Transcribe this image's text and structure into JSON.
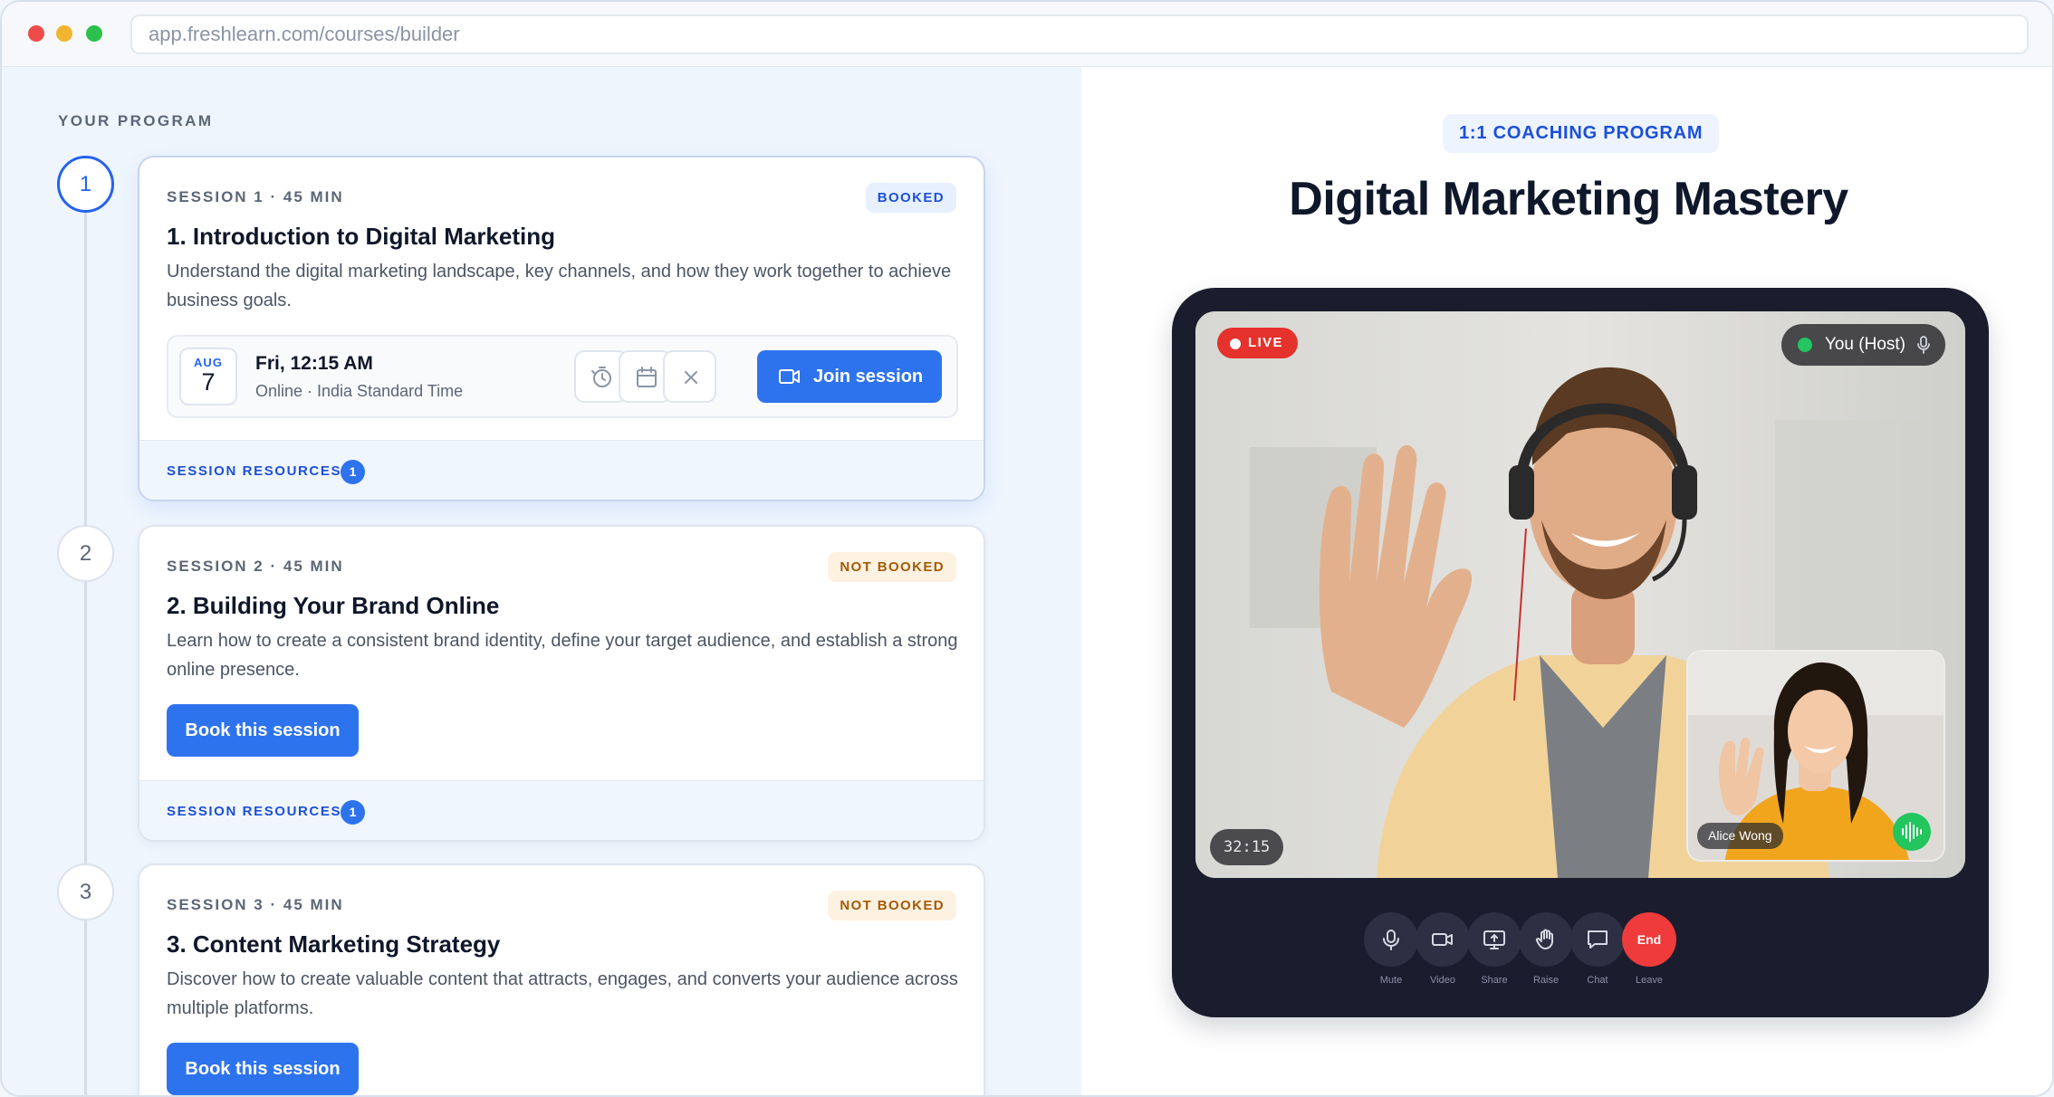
{
  "browser": {
    "url": "app.freshlearn.com/courses/builder"
  },
  "program": {
    "label": "YOUR PROGRAM",
    "sessions": [
      {
        "step": "1",
        "meta": "SESSION 1 · 45 MIN",
        "status": "BOOKED",
        "title": "1. Introduction to Digital Marketing",
        "description": "Understand the digital marketing landscape, key channels, and how they work together to achieve business goals.",
        "booking": {
          "month": "AUG",
          "day": "7",
          "time": "Fri, 12:15 AM",
          "location": "Online · India Standard Time",
          "join_label": "Join session"
        },
        "resources_label": "SESSION RESOURCES",
        "resources_count": "1"
      },
      {
        "step": "2",
        "meta": "SESSION 2 · 45 MIN",
        "status": "NOT BOOKED",
        "title": "2. Building Your Brand Online",
        "description": "Learn how to create a consistent brand identity, define your target audience, and establish a strong online presence.",
        "book_label": "Book this session",
        "resources_label": "SESSION RESOURCES",
        "resources_count": "1"
      },
      {
        "step": "3",
        "meta": "SESSION 3 · 45 MIN",
        "status": "NOT BOOKED",
        "title": "3. Content Marketing Strategy",
        "description": "Discover how to create valuable content that attracts, engages, and converts your audience across multiple platforms.",
        "book_label": "Book this session"
      }
    ]
  },
  "preview": {
    "tag": "1:1 COACHING PROGRAM",
    "title": "Digital Marketing Mastery",
    "call": {
      "live_label": "LIVE",
      "host_label": "You (Host)",
      "timer": "32:15",
      "participant_name": "Alice Wong",
      "controls": [
        {
          "label": "Mute",
          "icon": "mic-icon"
        },
        {
          "label": "Video",
          "icon": "video-icon"
        },
        {
          "label": "Share",
          "icon": "screen-share-icon"
        },
        {
          "label": "Raise",
          "icon": "hand-icon"
        },
        {
          "label": "Chat",
          "icon": "chat-icon"
        },
        {
          "label": "Leave",
          "icon": "end-call",
          "button_text": "End"
        }
      ]
    }
  },
  "colors": {
    "accent": "#2e73ee",
    "booked_badge": "#1d4fd8",
    "not_booked_badge": "#a35b07",
    "live": "#e5322d",
    "end_call": "#ef3b3b"
  }
}
